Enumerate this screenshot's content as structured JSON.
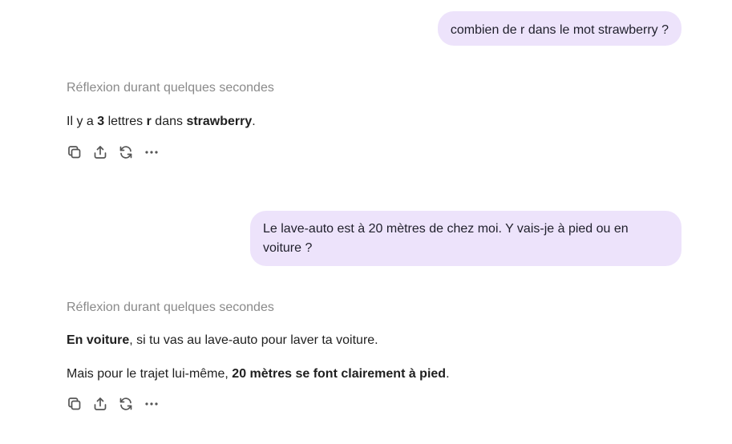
{
  "messages": [
    {
      "user": "combien de r dans le mot strawberry ?",
      "reasoning": "Réflexion durant quelques secondes",
      "answer": {
        "p1": {
          "t1": "Il y a ",
          "b1": "3",
          "t2": " lettres ",
          "b2": "r",
          "t3": " dans ",
          "b3": "strawberry",
          "t4": "."
        }
      }
    },
    {
      "user": "Le lave-auto est à 20 mètres de chez moi. Y vais-je à pied ou en voiture ?",
      "reasoning": "Réflexion durant quelques secondes",
      "answer": {
        "p1": {
          "b1": "En voiture",
          "t1": ", si tu vas au lave-auto pour laver ta voiture."
        },
        "p2": {
          "t1": "Mais pour le trajet lui-même, ",
          "b1": "20 mètres se font clairement à pied",
          "t2": "."
        }
      }
    }
  ],
  "action_icons": [
    "copy-icon",
    "share-icon",
    "regenerate-icon",
    "more-icon"
  ],
  "colors": {
    "user_bubble": "#ede3fb",
    "reasoning_text": "#8a8a8a",
    "body_text": "#1f1f1f",
    "icon": "#555555"
  }
}
